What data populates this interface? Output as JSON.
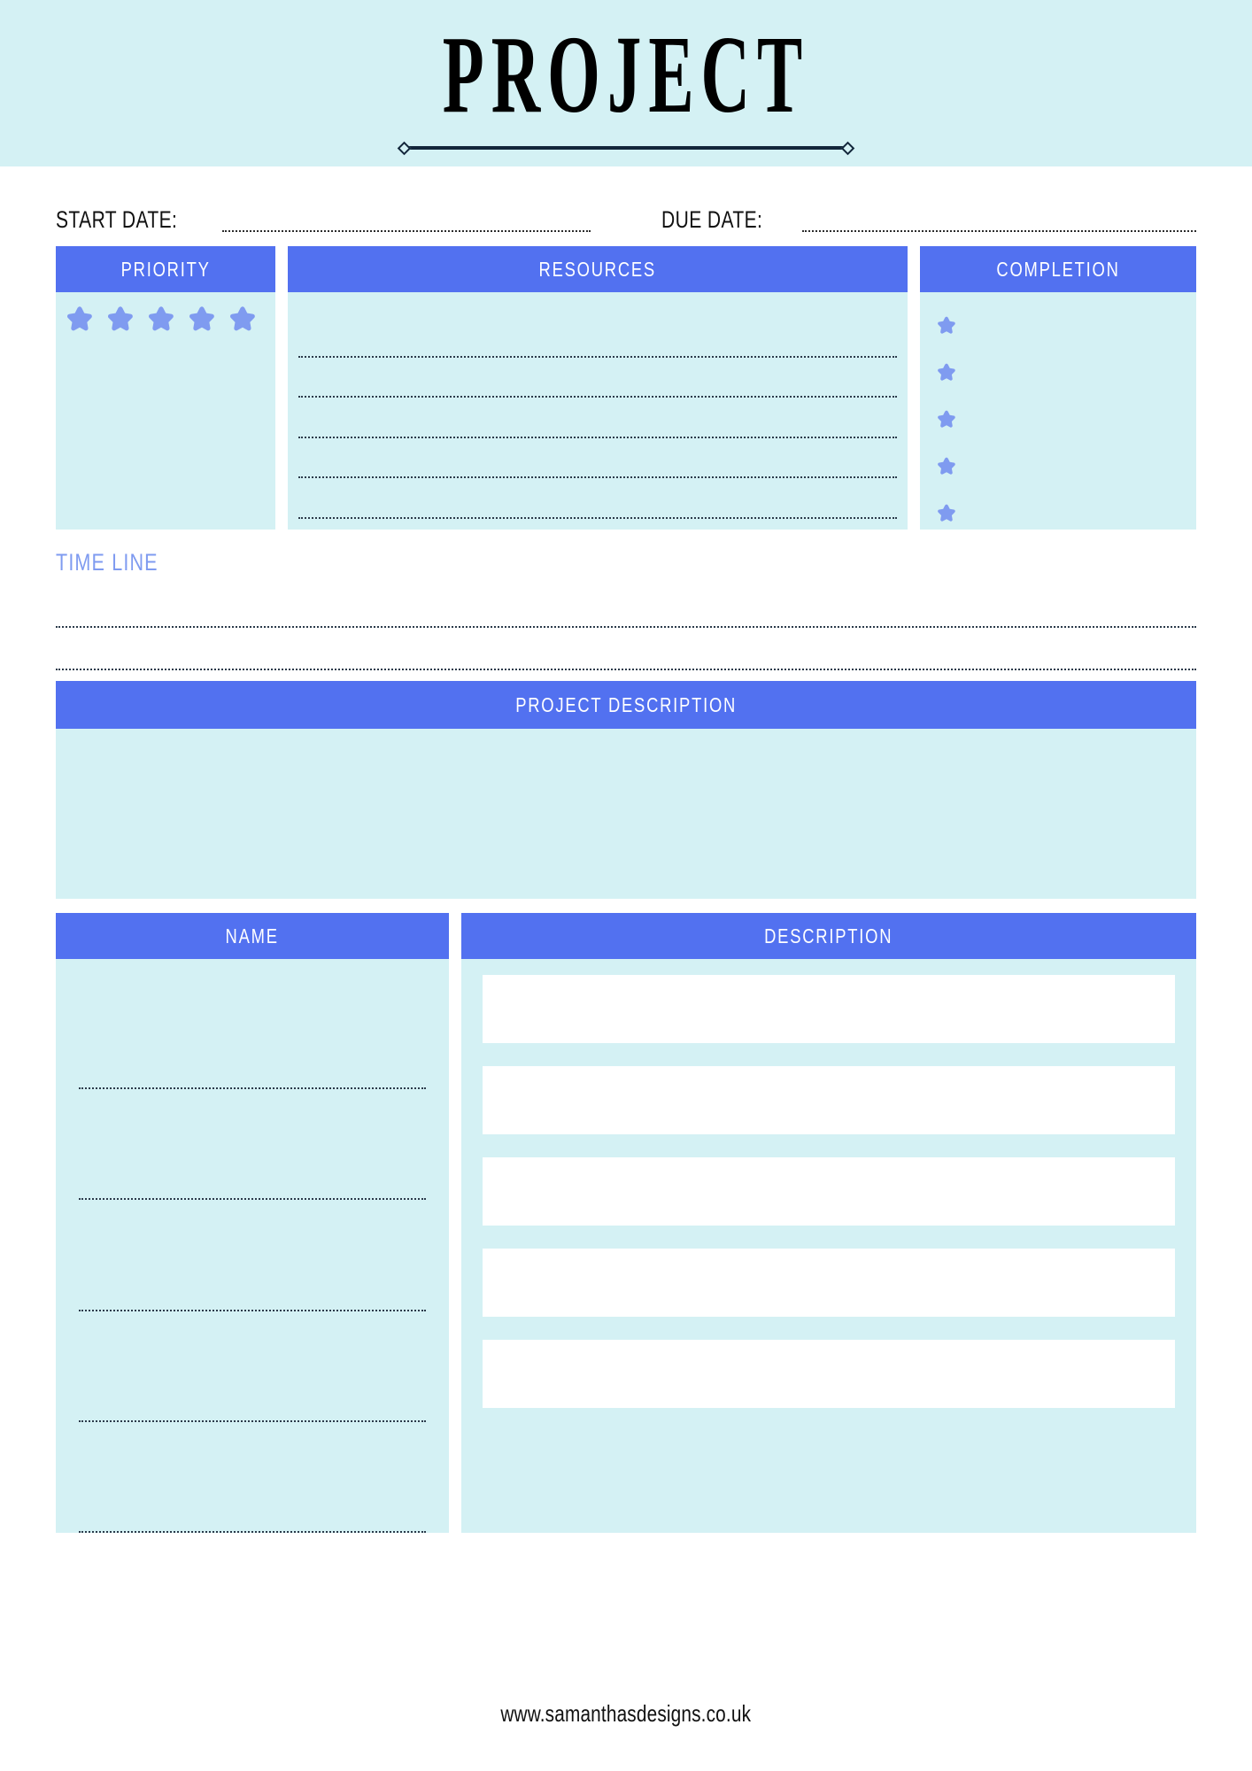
{
  "header": {
    "title": "PROJECT",
    "rule_icon": "diamond-rule"
  },
  "dates": {
    "start_label": "START DATE:",
    "start_value": "",
    "start_placeholder": "",
    "due_label": "DUE DATE:",
    "due_value": "",
    "due_placeholder": ""
  },
  "priority": {
    "header": "PRIORITY",
    "star_count": 5,
    "stars_filled": 0,
    "star_color": "#7f9bf0"
  },
  "resources": {
    "header": "RESOURCES",
    "line_count": 5,
    "lines": [
      "",
      "",
      "",
      "",
      ""
    ]
  },
  "completion": {
    "header": "COMPLETION",
    "star_count": 5,
    "stars_filled": 0,
    "star_color": "#7f9bf0"
  },
  "timeline": {
    "label": "TIME LINE",
    "line_count": 2,
    "lines": [
      "",
      ""
    ]
  },
  "project_description": {
    "header": "PROJECT DESCRIPTION",
    "value": ""
  },
  "task_table": {
    "name_header": "NAME",
    "description_header": "DESCRIPTION",
    "row_count": 5,
    "names": [
      "",
      "",
      "",
      "",
      ""
    ],
    "descriptions": [
      "",
      "",
      "",
      "",
      ""
    ]
  },
  "footer": {
    "url": "www.samanthasdesigns.co.uk"
  },
  "colors": {
    "band": "#d4f1f4",
    "panel": "#d4f1f4",
    "accent_bar": "#5271f0",
    "star": "#7f9bf0",
    "rule": "#12263a",
    "page": "#ffffff"
  }
}
